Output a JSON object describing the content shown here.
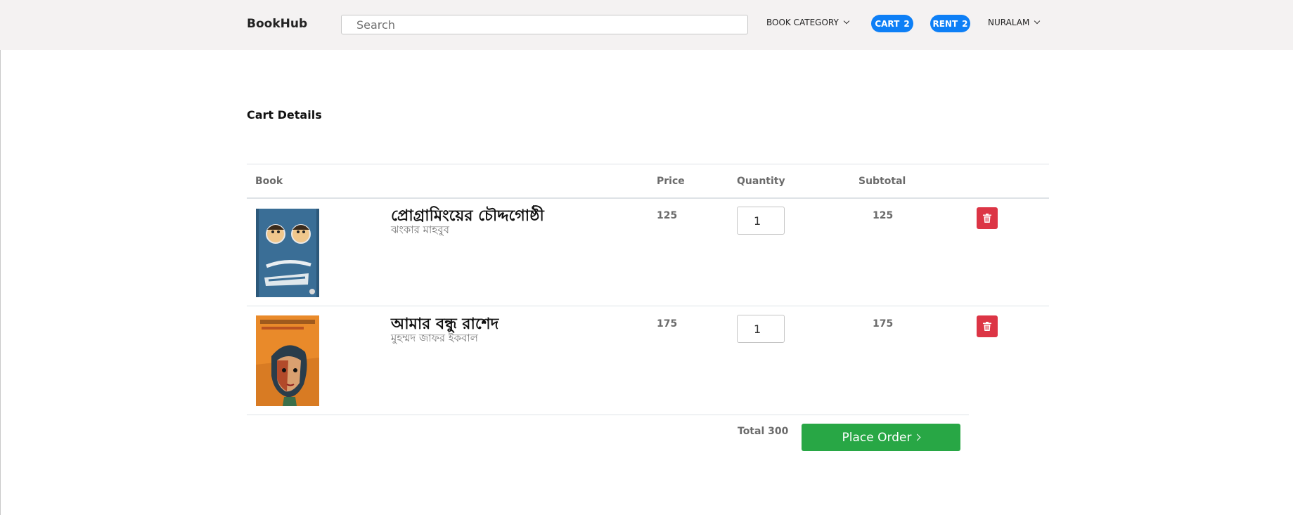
{
  "navbar": {
    "brand": "BookHub",
    "search_placeholder": "Search",
    "category_label": "BOOK CATEGORY",
    "cart_label": "CART",
    "cart_count": "2",
    "rent_label": "RENT",
    "rent_count": "2",
    "user_label": "NURALAM"
  },
  "page": {
    "title": "Cart Details"
  },
  "table": {
    "headers": {
      "book": "Book",
      "price": "Price",
      "quantity": "Quantity",
      "subtotal": "Subtotal"
    },
    "rows": [
      {
        "title": "প্রোগ্রামিংয়ের চৌদ্দগোষ্ঠী",
        "author": "ঝংকার মাহবুব",
        "price": "125",
        "quantity": "1",
        "subtotal": "125",
        "cover_icon": "book-cover-blue"
      },
      {
        "title": "আমার বন্ধু রাশেদ",
        "author": "মুহম্মদ জাফর ইকবাল",
        "price": "175",
        "quantity": "1",
        "subtotal": "175",
        "cover_icon": "book-cover-orange"
      }
    ]
  },
  "summary": {
    "total_label": "Total 300",
    "order_button": "Place Order"
  },
  "colors": {
    "accent": "#0d7ff6",
    "danger": "#dc3545",
    "success": "#28a745",
    "navbar_bg": "#f4f2f2"
  }
}
